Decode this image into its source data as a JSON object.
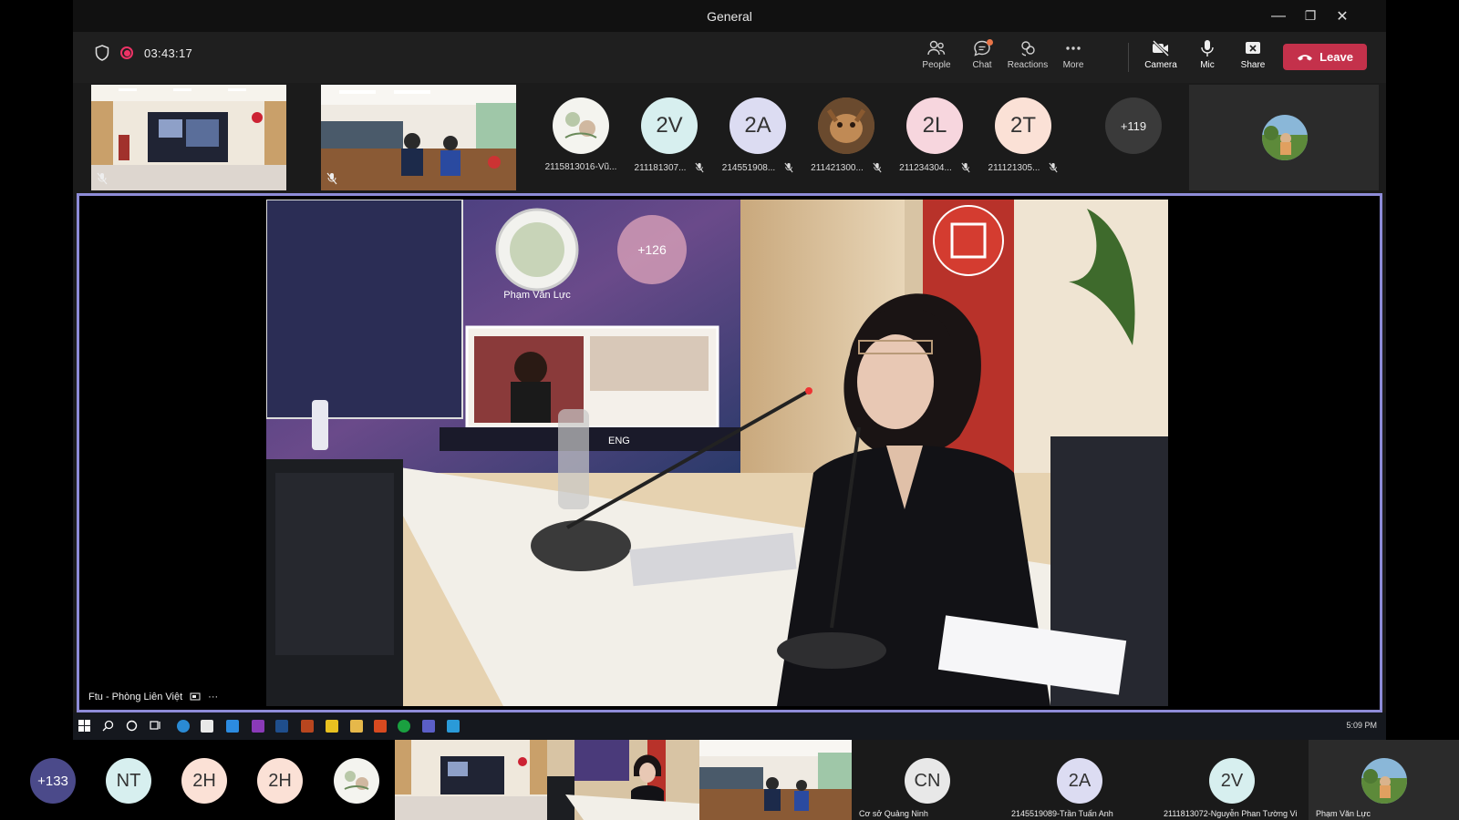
{
  "window": {
    "title": "General",
    "controls": {
      "minimize": "—",
      "restore": "❐",
      "close": "✕"
    }
  },
  "toolbar": {
    "timer": "03:43:17",
    "buttons": {
      "people": "People",
      "chat": "Chat",
      "reactions": "Reactions",
      "more": "More",
      "camera": "Camera",
      "mic": "Mic",
      "share": "Share"
    },
    "leave": "Leave",
    "colors": {
      "leave": "#c4314b",
      "accent": "#8e8cd8",
      "recording": "#ee3366"
    }
  },
  "strip": {
    "participants": [
      {
        "initials": "",
        "name": "2115813016-Vũ...",
        "color": "#f2f2ee",
        "icon": "floral-avatar-icon",
        "muted": false
      },
      {
        "initials": "2V",
        "name": "211181307...",
        "color": "#d7efef",
        "muted": true
      },
      {
        "initials": "2A",
        "name": "214551908...",
        "color": "#dcdcf2",
        "muted": true
      },
      {
        "initials": "",
        "name": "211421300...",
        "color": "#7a5a3a",
        "icon": "photo-avatar-icon",
        "muted": true
      },
      {
        "initials": "2L",
        "name": "211234304...",
        "color": "#f7d6de",
        "muted": true
      },
      {
        "initials": "2T",
        "name": "211121305...",
        "color": "#fbe1d6",
        "muted": true
      }
    ],
    "overflow": "+119"
  },
  "stage": {
    "speaker_label": "Ftu - Phòng Liên Việt",
    "more_label": "···",
    "on_screen": {
      "name": "Phạm Văn Lực",
      "overflow": "+126",
      "lang": "ENG"
    }
  },
  "taskbar": {
    "clock": "5:09 PM"
  },
  "gallery": {
    "overflow": "+133",
    "avatars": [
      {
        "initials": "NT",
        "color": "#d7efef"
      },
      {
        "initials": "2H",
        "color": "#fbe1d6"
      },
      {
        "initials": "2H",
        "color": "#fbe1d6"
      }
    ],
    "named_tiles": [
      {
        "initials": "CN",
        "name": "Cơ sở Quảng Ninh",
        "color": "#e8e8e8"
      },
      {
        "initials": "2A",
        "name": "2145519089-Trần Tuấn Anh",
        "color": "#dcdcf2"
      },
      {
        "initials": "2V",
        "name": "2111813072-Nguyễn Phan Tường Vi",
        "color": "#d7efef"
      }
    ],
    "self_name": "Phạm Văn Lực"
  }
}
